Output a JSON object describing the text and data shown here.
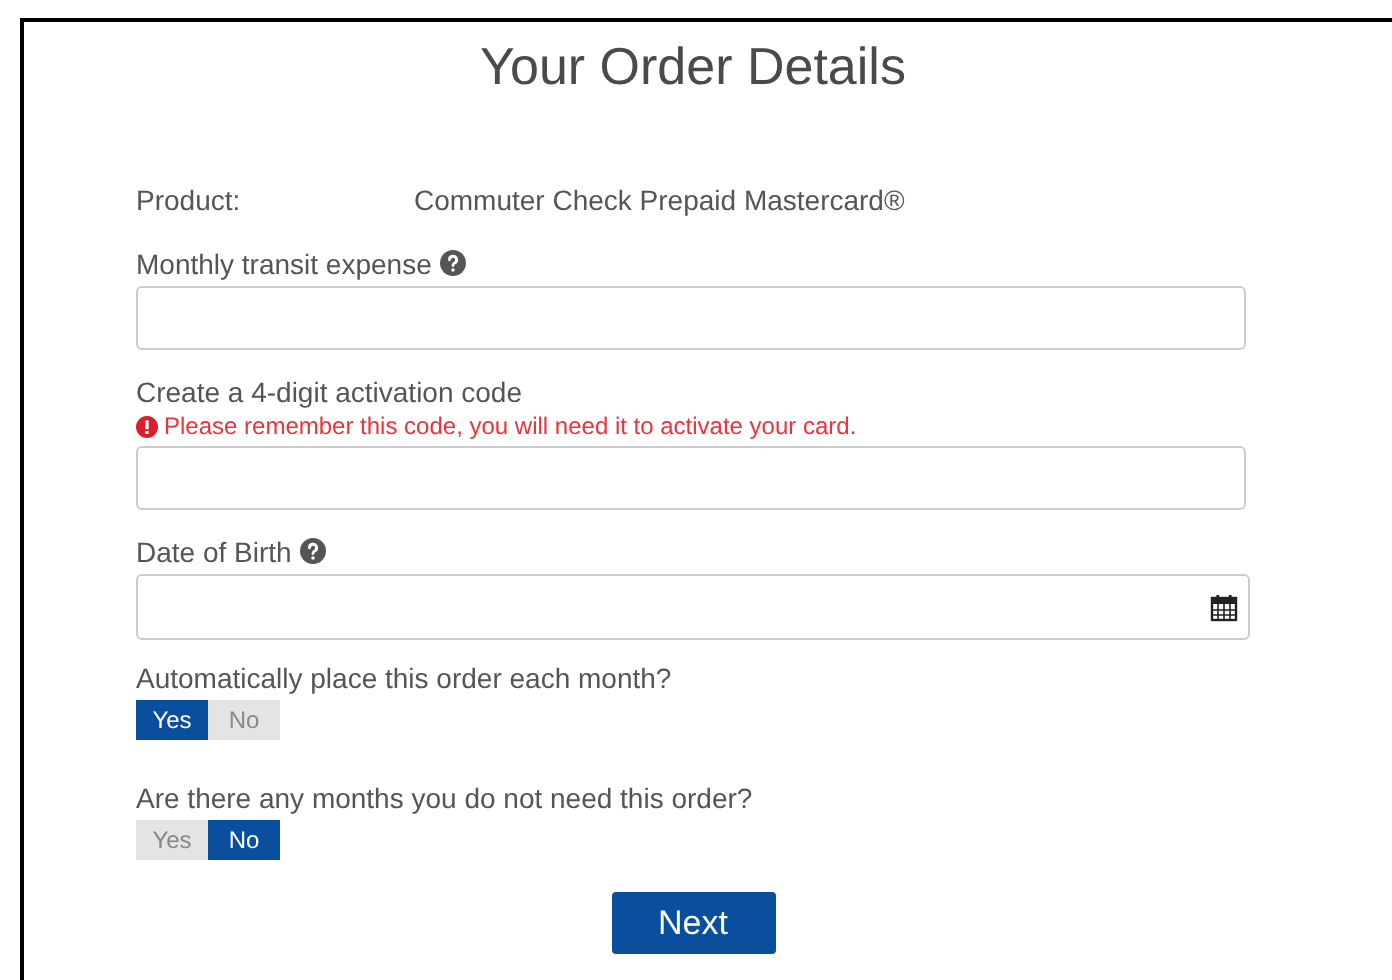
{
  "title": "Your Order Details",
  "product": {
    "label": "Product:",
    "value": "Commuter Check Prepaid Mastercard®"
  },
  "fields": [
    {
      "kind": "text",
      "label": "Monthly transit expense",
      "help": true
    },
    {
      "kind": "text",
      "label": "Create a 4-digit activation code",
      "help": false,
      "warning": "Please remember this code, you will need it to activate your card."
    },
    {
      "kind": "date",
      "label": "Date of Birth",
      "help": true
    }
  ],
  "questions": [
    {
      "label": "Automatically place this order each month?",
      "options": [
        {
          "label": "Yes",
          "selected": true
        },
        {
          "label": "No",
          "selected": false
        }
      ]
    },
    {
      "label": "Are there any months you do not need this order?",
      "options": [
        {
          "label": "Yes",
          "selected": false
        },
        {
          "label": "No",
          "selected": true
        }
      ]
    }
  ],
  "next_button": "Next"
}
